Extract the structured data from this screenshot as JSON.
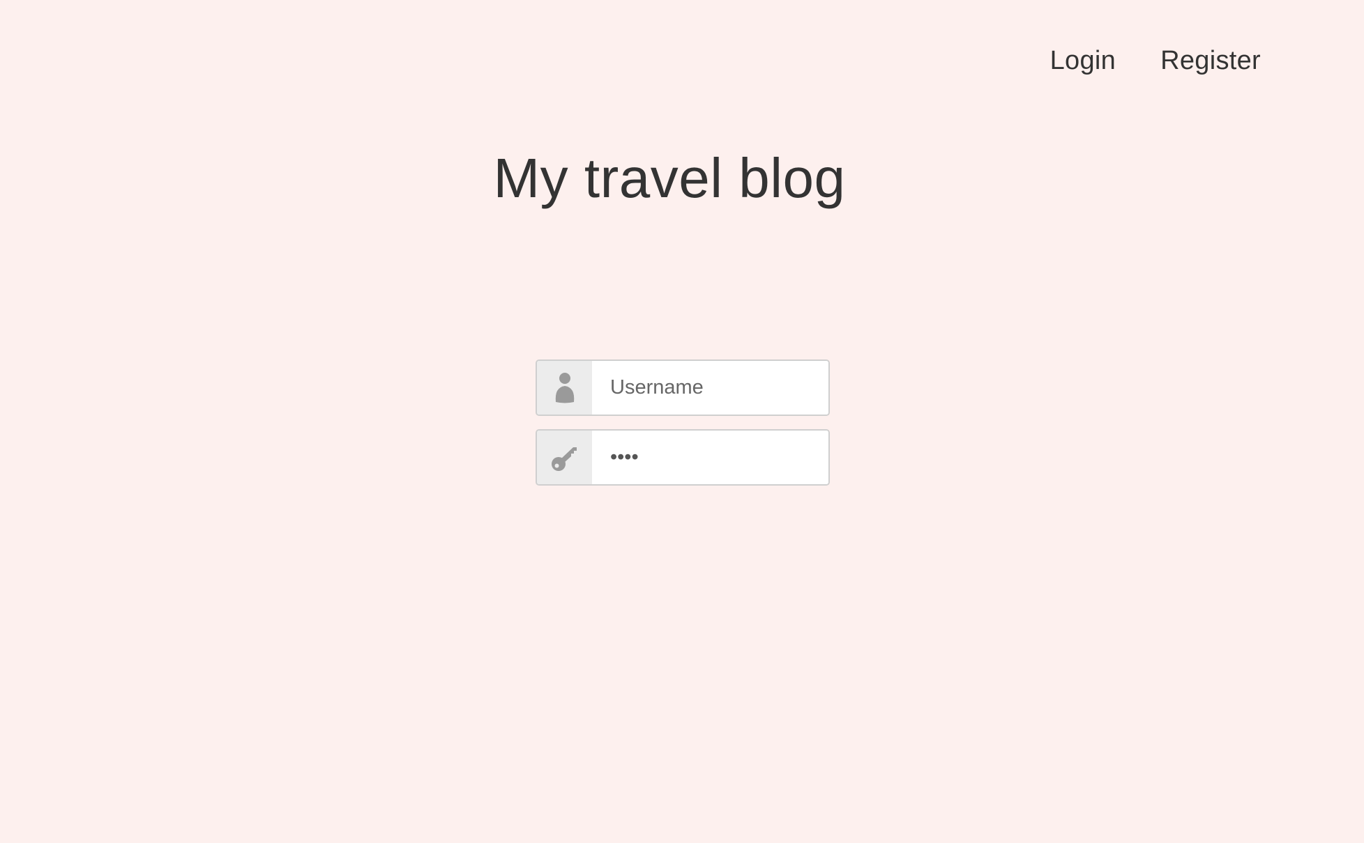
{
  "nav": {
    "login_label": "Login",
    "register_label": "Register"
  },
  "header": {
    "title": "My travel blog"
  },
  "form": {
    "username": {
      "value": "",
      "placeholder": "Username",
      "icon": "user-icon"
    },
    "password": {
      "value": "••••",
      "icon": "key-icon"
    }
  },
  "colors": {
    "background": "#fdf0ee",
    "text": "#333333",
    "addon_background": "#ececec",
    "icon": "#9a9a9a",
    "border": "#cfcfcf"
  }
}
